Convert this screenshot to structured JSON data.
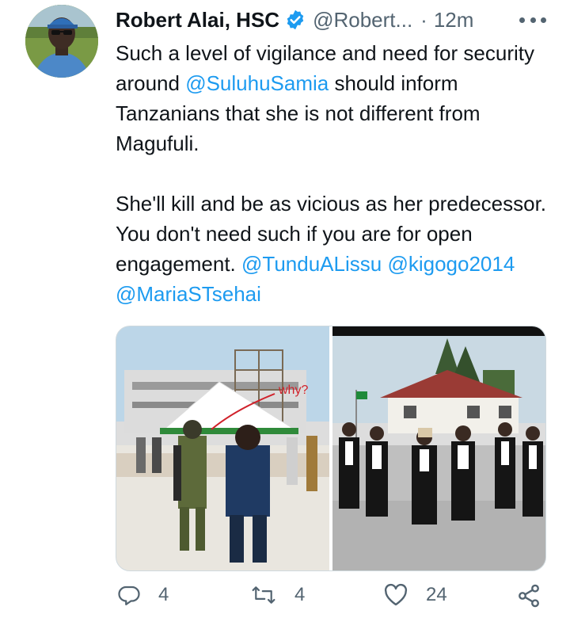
{
  "tweet": {
    "display_name": "Robert Alai, HSC",
    "handle": "@Robert...",
    "separator": "·",
    "time": "12m",
    "body": {
      "p1_a": "Such a level of vigilance and need for security around ",
      "p1_mention": "@SuluhuSamia",
      "p1_b": " should inform Tanzanians that she is not different from Magufuli.",
      "p2_a": "She'll kill and be as vicious as her predecessor. You don't need such if you are for open engagement. ",
      "p2_m1": "@TunduALissu",
      "p2_m2": "@kigogo2014",
      "p2_m3": "@MariaSTsehai"
    },
    "media_annotation": "why?",
    "actions": {
      "reply_count": "4",
      "retweet_count": "4",
      "like_count": "24"
    }
  },
  "icons": {
    "verified": "verified-badge-icon",
    "more": "more-icon",
    "reply": "reply-icon",
    "retweet": "retweet-icon",
    "like": "like-icon",
    "share": "share-icon"
  },
  "colors": {
    "mention": "#1d9bf0",
    "verified": "#1d9bf0",
    "secondary_text": "#536471",
    "primary_text": "#0f1419"
  }
}
